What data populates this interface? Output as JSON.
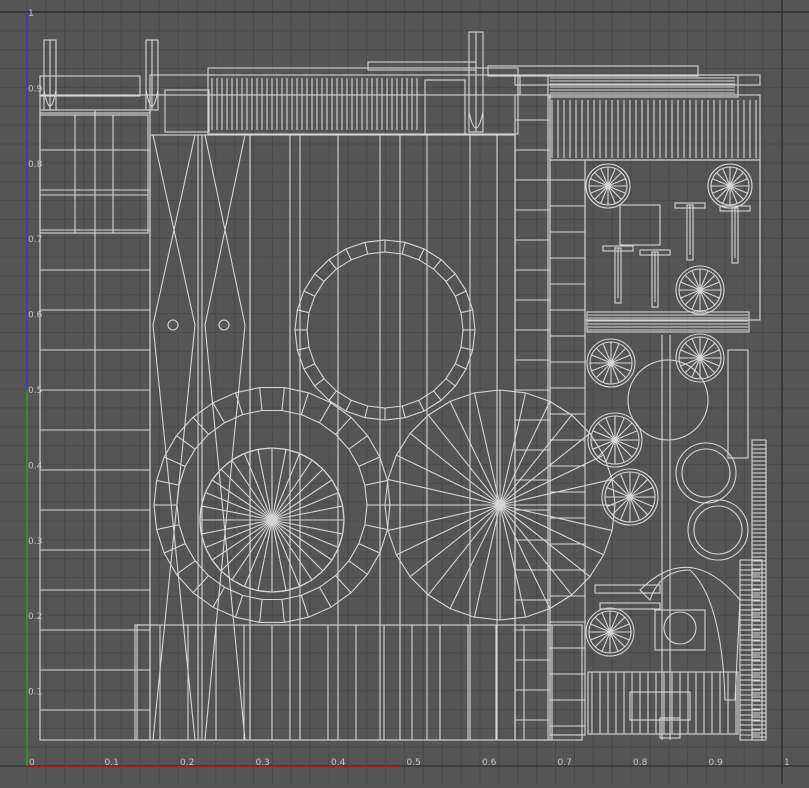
{
  "editor": {
    "title": "",
    "view": "UV Editor",
    "colors": {
      "background": "#555555",
      "grid": "#4a4a4a",
      "gridMajor": "#2d2d2d",
      "wire": "#d6d6d6",
      "uAxis": "#c02020",
      "vAxis": "#2fa02f",
      "vAxisTop": "#3838c8"
    }
  },
  "axes": {
    "u_ticks": [
      {
        "label": "0",
        "value": 0.0
      },
      {
        "label": "0.1",
        "value": 0.1
      },
      {
        "label": "0.2",
        "value": 0.2
      },
      {
        "label": "0.3",
        "value": 0.3
      },
      {
        "label": "0.4",
        "value": 0.4
      },
      {
        "label": "0.5",
        "value": 0.5
      },
      {
        "label": "0.6",
        "value": 0.6
      },
      {
        "label": "0.7",
        "value": 0.7
      },
      {
        "label": "0.8",
        "value": 0.8
      },
      {
        "label": "0.9",
        "value": 0.9
      },
      {
        "label": "1",
        "value": 1.0
      }
    ],
    "v_ticks": [
      {
        "label": "0.1",
        "value": 0.1
      },
      {
        "label": "0.2",
        "value": 0.2
      },
      {
        "label": "0.3",
        "value": 0.3
      },
      {
        "label": "0.4",
        "value": 0.4
      },
      {
        "label": "0.5",
        "value": 0.5
      },
      {
        "label": "0.6",
        "value": 0.6
      },
      {
        "label": "0.7",
        "value": 0.7
      },
      {
        "label": "0.8",
        "value": 0.8
      },
      {
        "label": "0.9",
        "value": 0.9
      },
      {
        "label": "1",
        "value": 1.0
      }
    ]
  }
}
